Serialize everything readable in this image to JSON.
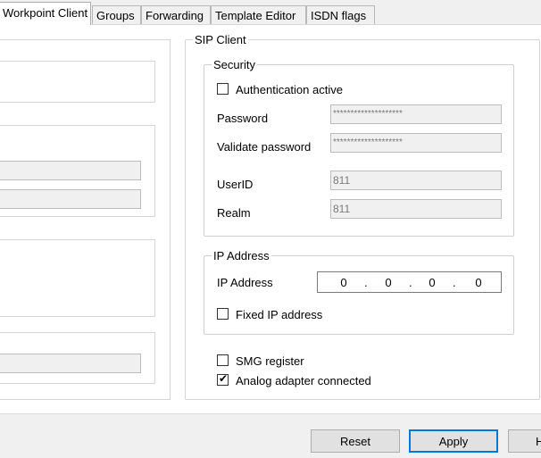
{
  "tabs": [
    {
      "label": "Workpoint Client"
    },
    {
      "label": "Groups"
    },
    {
      "label": "Forwarding"
    },
    {
      "label": "Template Editor"
    },
    {
      "label": "ISDN flags"
    }
  ],
  "sip_client": {
    "title": "SIP Client",
    "security": {
      "title": "Security",
      "auth_active_label": "Authentication active",
      "auth_active_checked": false,
      "password_label": "Password",
      "password_value": "********************",
      "validate_password_label": "Validate password",
      "validate_password_value": "********************",
      "userid_label": "UserID",
      "userid_value": "811",
      "realm_label": "Realm",
      "realm_value": "811"
    },
    "ip_address": {
      "title": "IP Address",
      "ip_label": "IP Address",
      "octets": [
        "0",
        "0",
        "0",
        "0"
      ],
      "fixed_ip_label": "Fixed IP address",
      "fixed_ip_checked": false
    },
    "smg_register_label": "SMG register",
    "smg_register_checked": false,
    "analog_adapter_label": "Analog adapter connected",
    "analog_adapter_checked": true,
    "checkmark": "✔"
  },
  "buttons": {
    "reset": "Reset",
    "apply": "Apply",
    "help": "H"
  }
}
